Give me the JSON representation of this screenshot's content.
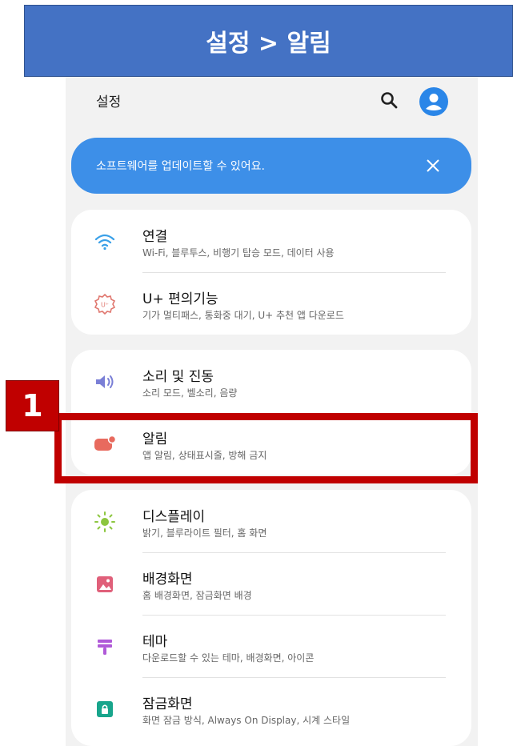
{
  "banner": {
    "title": "설정 > 알림"
  },
  "topbar": {
    "title": "설정"
  },
  "update_banner": {
    "text": "소프트웨어를 업데이트할 수 있어요."
  },
  "cards": [
    {
      "items": [
        {
          "icon": "wifi-icon",
          "title": "연결",
          "subtitle": "Wi-Fi, 블루투스, 비행기 탑승 모드, 데이터 사용"
        },
        {
          "icon": "u-plus-icon",
          "title": "U+ 편의기능",
          "subtitle": "기가 멀티패스, 통화중 대기, U+ 추천 앱 다운로드"
        }
      ]
    },
    {
      "items": [
        {
          "icon": "speaker-icon",
          "title": "소리 및 진동",
          "subtitle": "소리 모드, 벨소리, 음량"
        },
        {
          "icon": "notification-icon",
          "title": "알림",
          "subtitle": "앱 알림, 상태표시줄, 방해 금지"
        }
      ]
    },
    {
      "items": [
        {
          "icon": "sun-icon",
          "title": "디스플레이",
          "subtitle": "밝기, 블루라이트 필터, 홈 화면"
        },
        {
          "icon": "wallpaper-icon",
          "title": "배경화면",
          "subtitle": "홈 배경화면, 잠금화면 배경"
        },
        {
          "icon": "theme-brush-icon",
          "title": "테마",
          "subtitle": "다운로드할 수 있는 테마, 배경화면, 아이콘"
        },
        {
          "icon": "lock-icon",
          "title": "잠금화면",
          "subtitle": "화면 잠금 방식, Always On Display, 시계 스타일"
        }
      ]
    }
  ],
  "step_badge": "1",
  "colors": {
    "banner": "#4472c4",
    "accent": "#3d8fe8",
    "highlight": "#c00000"
  }
}
